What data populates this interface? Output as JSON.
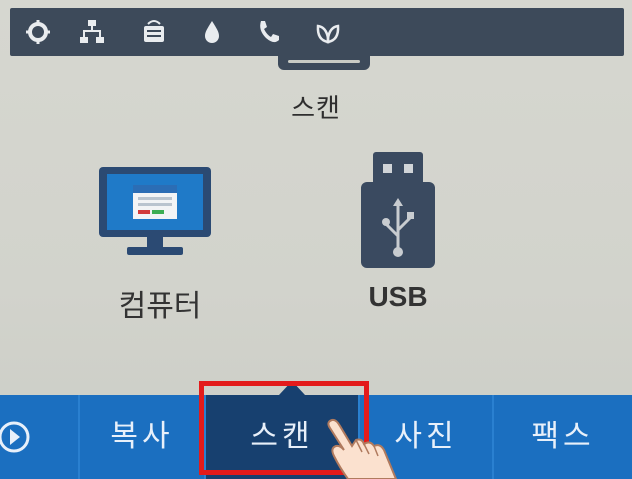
{
  "status_bar": {
    "icons": [
      "settings-icon",
      "network-icon",
      "wireless-direct-icon",
      "ink-icon",
      "fax-icon",
      "eco-icon"
    ]
  },
  "page": {
    "title": "스캔"
  },
  "options": [
    {
      "label": "컴퓨터",
      "icon": "computer-icon"
    },
    {
      "label": "USB",
      "icon": "usb-drive-icon"
    }
  ],
  "nav": {
    "items": [
      {
        "label": "복사"
      },
      {
        "label": "스캔"
      },
      {
        "label": "사진"
      },
      {
        "label": "팩스"
      }
    ],
    "active_index": 1
  },
  "colors": {
    "status_bar": "#3d4a5a",
    "nav_bg": "#1b6fc0",
    "nav_active": "#17406f",
    "highlight": "#e31b1b"
  }
}
